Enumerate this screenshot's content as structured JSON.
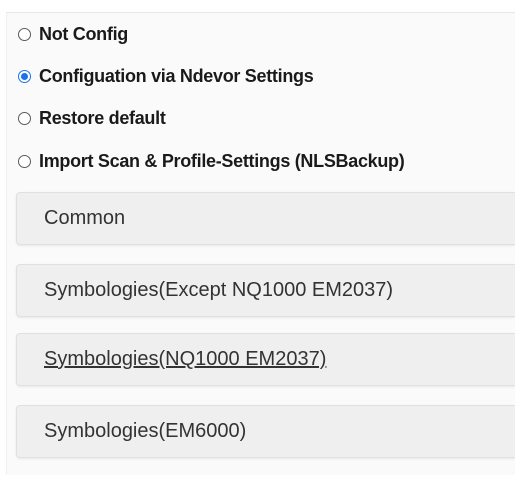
{
  "options": [
    {
      "label": "Not Config",
      "checked": false
    },
    {
      "label": "Configuation via Ndevor Settings",
      "checked": true
    },
    {
      "label": "Restore default",
      "checked": false
    },
    {
      "label": "Import Scan & Profile-Settings (NLSBackup)",
      "checked": false
    }
  ],
  "sections": [
    {
      "label": "Common"
    },
    {
      "label": "Symbologies(Except NQ1000 EM2037)"
    },
    {
      "label": "Symbologies(NQ1000 EM2037)"
    },
    {
      "label": "Symbologies(EM6000)"
    }
  ],
  "colors": {
    "accent": "#1a73e8",
    "section_bg": "#efefef"
  }
}
